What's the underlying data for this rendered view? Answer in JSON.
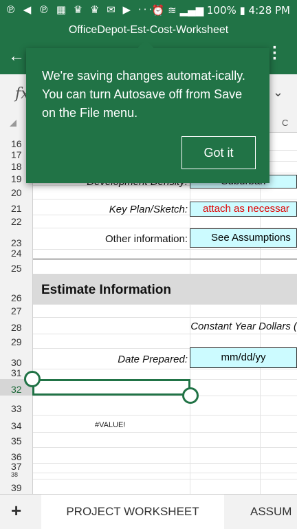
{
  "status": {
    "left_icons": "℗ ◀ ℗ ▦ ♛ ♛ ✉ ▶ ···",
    "right": "⏰ ≋ ▂▄▆ 100% ▮ 4:28 PM"
  },
  "window": {
    "title": "OfficeDepot-Est-Cost-Worksheet"
  },
  "formula_bar": {
    "fx": "fx",
    "chevron": "⌄"
  },
  "columns": {
    "visible": "C"
  },
  "toast": {
    "message": "We're saving changes automat-ically. You can turn Autosave off from Save on the File menu.",
    "button": "Got it"
  },
  "rows": [
    "16",
    "17",
    "18",
    "19",
    "20",
    "21",
    "22",
    "23",
    "24",
    "25",
    "26",
    "27",
    "28",
    "29",
    "30",
    "31",
    "32",
    "33",
    "34",
    "35",
    "36",
    "37",
    "38",
    "39"
  ],
  "sheet": {
    "r19_label": "Development Density:",
    "r19_value": "Suburban",
    "r21_label": "Key Plan/Sketch:",
    "r21_value": "attach as necessar",
    "r23_label": "Other information:",
    "r23_value": "See Assumptions",
    "r26_heading": "Estimate Information",
    "r28_text": "Constant Year Dollars (",
    "r30_label": "Date Prepared:",
    "r30_value": "mm/dd/yy",
    "r34_value": "#VALUE!"
  },
  "tabs": {
    "add": "+",
    "active": "PROJECT WORKSHEET",
    "next": "ASSUM"
  },
  "colors": {
    "excel_green": "#217346",
    "input_fill": "#ccfbff",
    "error_red": "#e00000"
  }
}
